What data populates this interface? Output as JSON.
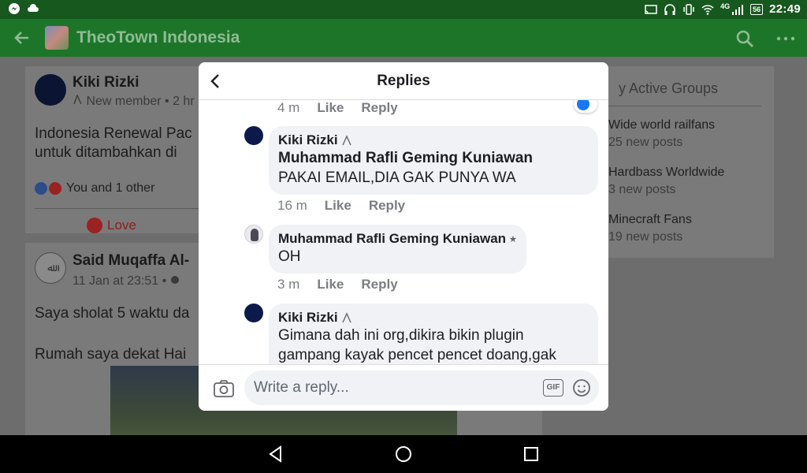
{
  "statusbar": {
    "network": "4G",
    "battery": "56",
    "time": "22:49"
  },
  "appbar": {
    "title": "TheoTown Indonesia"
  },
  "feed": {
    "post1": {
      "author": "Kiki Rizki",
      "meta": "New member • 2 hr",
      "text_line1": "Indonesia Renewal Pac",
      "text_line2": "untuk ditambahkan di",
      "reactions": "You and 1 other",
      "love_label": "Love"
    },
    "post2": {
      "author": "Said Muqaffa Al-",
      "meta": "11 Jan at 23:51 •",
      "text_line1": "Saya sholat 5 waktu da",
      "text_line2": "Rumah saya dekat Hai"
    },
    "sidebar": {
      "title": "y Active Groups",
      "groups": [
        {
          "name": "Wide world railfans",
          "sub": "25 new posts"
        },
        {
          "name": "Hardbass Worldwide",
          "sub": "3 new posts"
        },
        {
          "name": "Minecraft Fans",
          "sub": "19 new posts"
        }
      ]
    }
  },
  "modal": {
    "title": "Replies",
    "top_meta": {
      "time": "4 m",
      "like": "Like",
      "reply": "Reply"
    },
    "comments": [
      {
        "author": "Kiki Rizki",
        "mention": "Muhammad Rafli Geming Kuniawan",
        "text": "PAKAI EMAIL,DIA GAK PUNYA WA",
        "time": "16 m",
        "like": "Like",
        "reply": "Reply"
      },
      {
        "author": "Muhammad Rafli Geming Kuniawan",
        "text": "OH",
        "time": "3 m",
        "like": "Like",
        "reply": "Reply"
      },
      {
        "author": "Kiki Rizki",
        "text_line1": "Gimana dah ini org,dikira bikin plugin",
        "text_line2": "gampang kayak pencet pencet doang,gak"
      }
    ],
    "footer": {
      "placeholder": "Write a reply...",
      "gif_label": "GIF"
    }
  },
  "colors": {
    "statusbar": "#17581f",
    "appbar": "#1d7529",
    "bubble": "#f0f2f5",
    "like_blue": "#1877f2"
  }
}
